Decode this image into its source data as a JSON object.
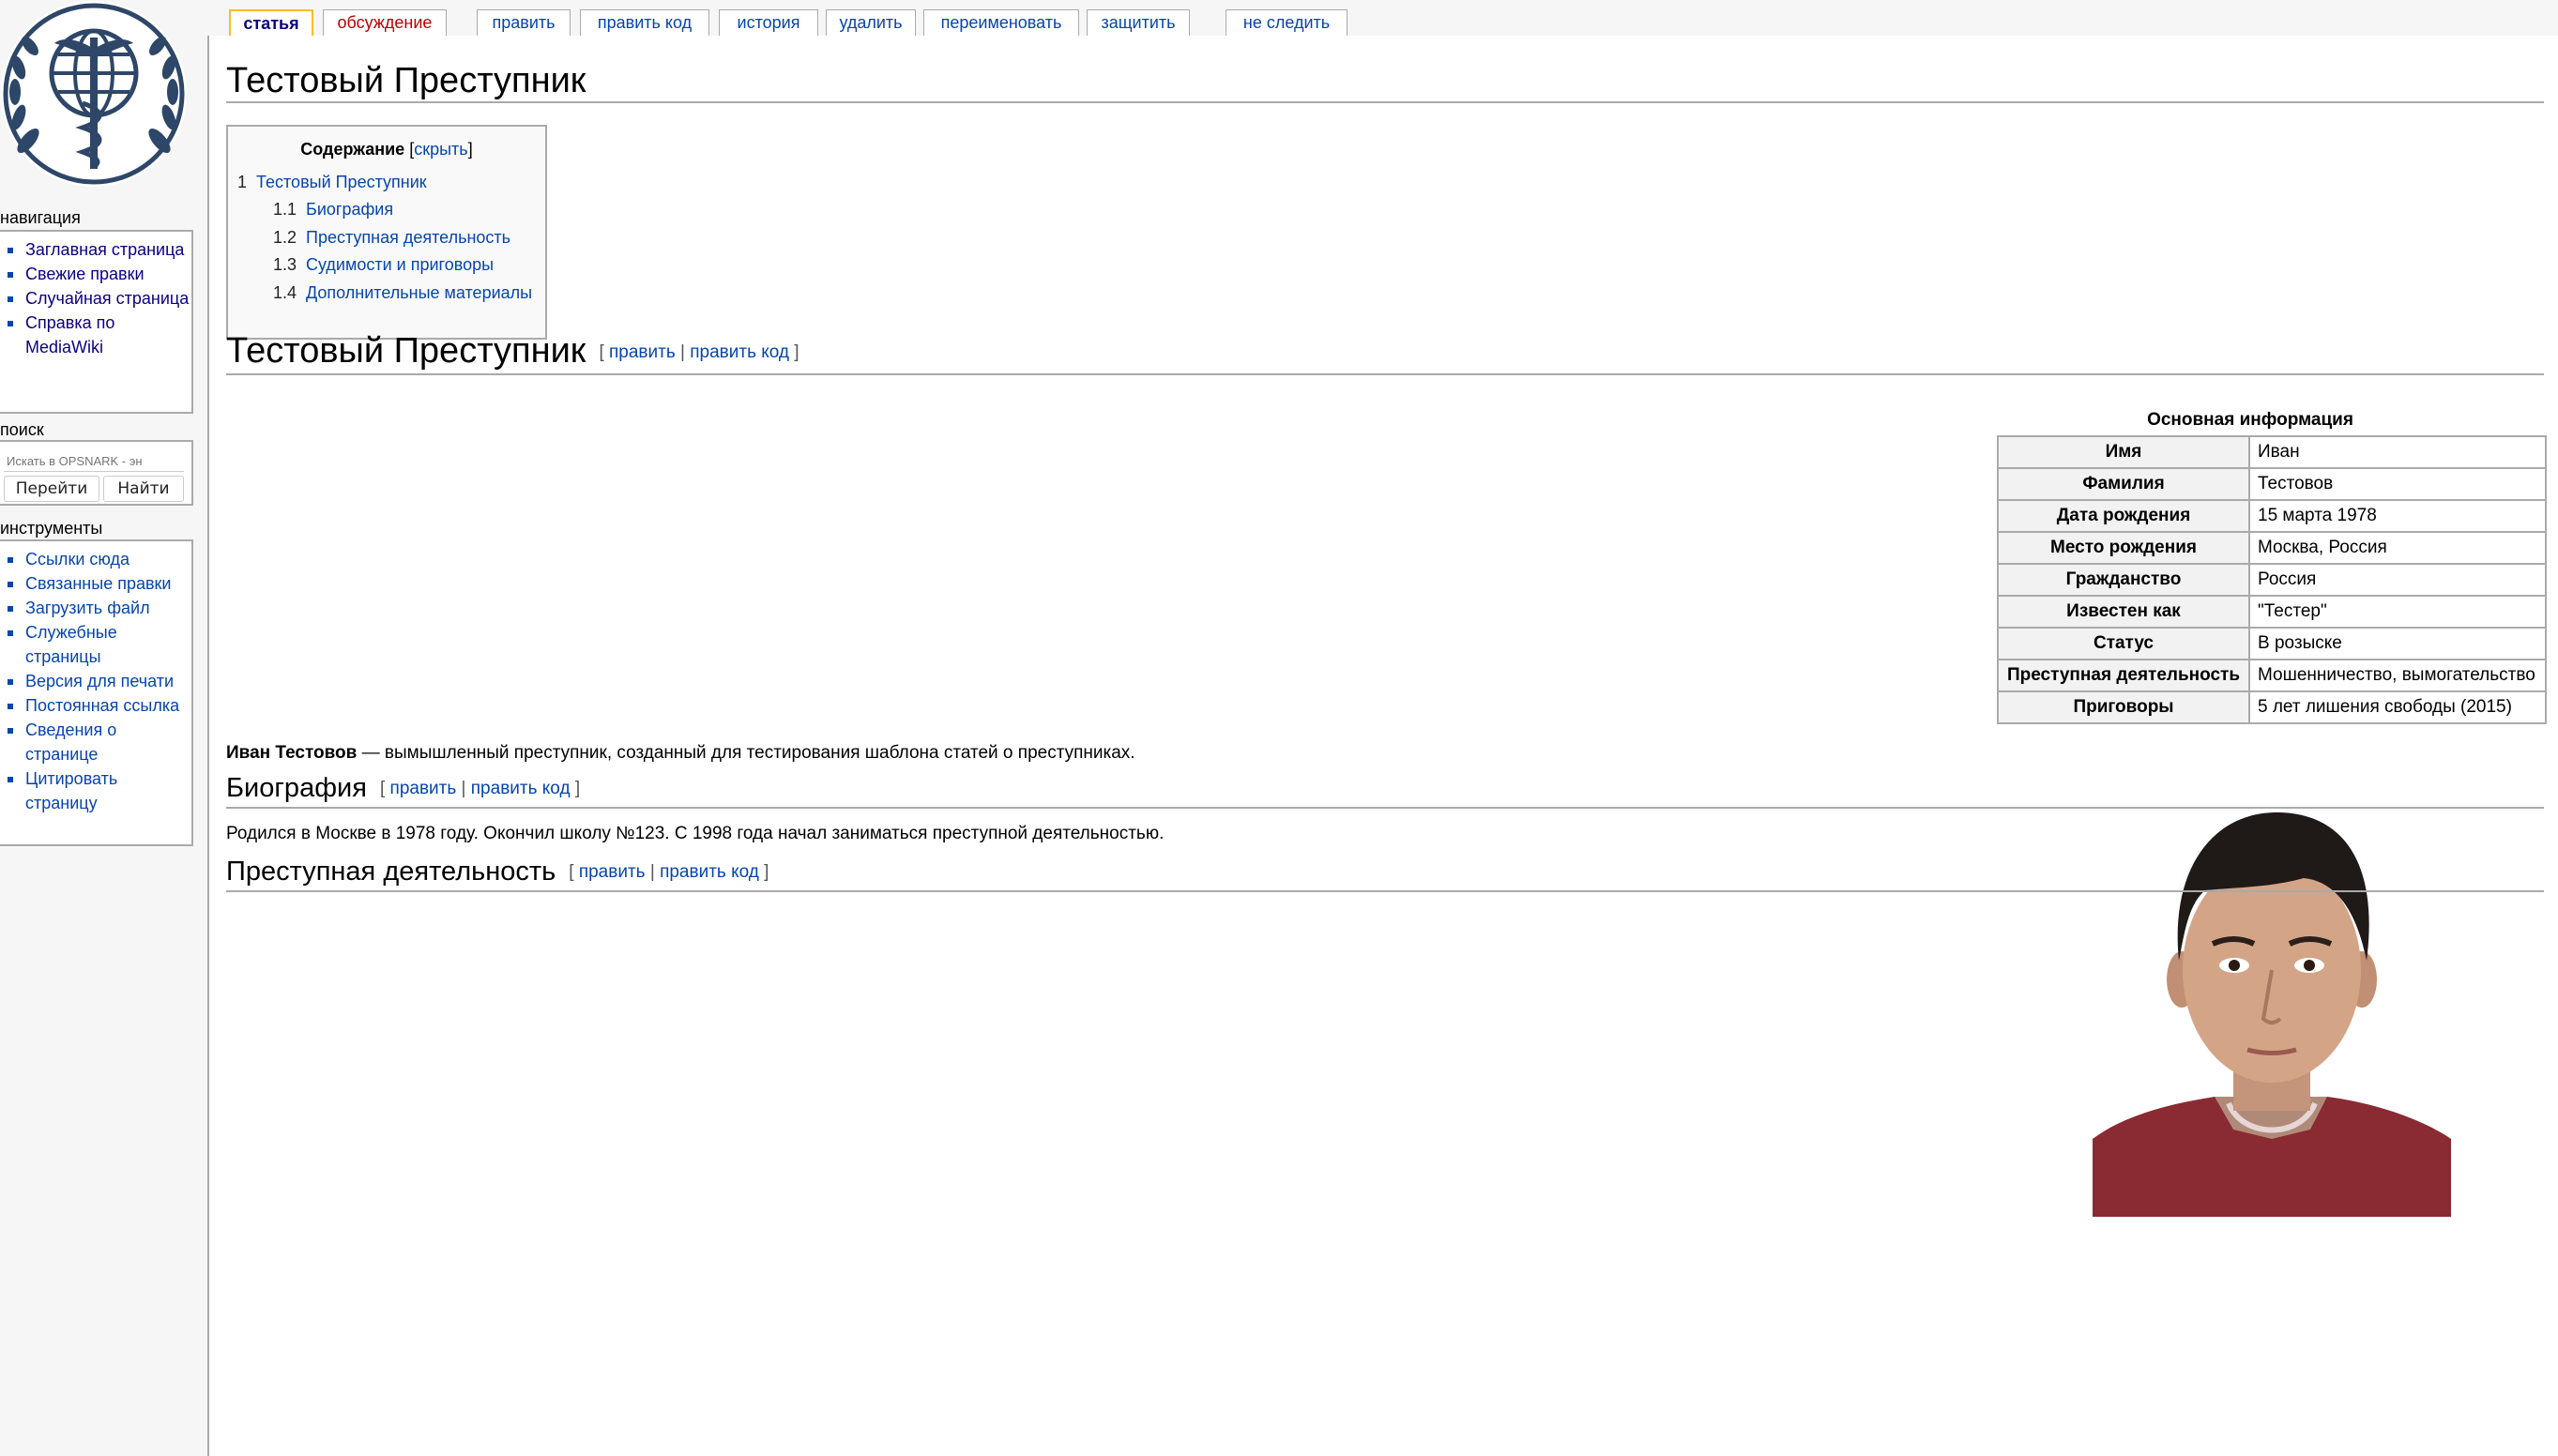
{
  "sidebar": {
    "navigation_title": "навигация",
    "navigation": [
      "Заглавная страница",
      "Свежие правки",
      "Случайная страница",
      "Справка по MediaWiki"
    ],
    "search_title": "поиск",
    "search_placeholder": "Искать в OPSNARK - эн",
    "go_button": "Перейти",
    "find_button": "Найти",
    "tools_title": "инструменты",
    "tools": [
      "Ссылки сюда",
      "Связанные правки",
      "Загрузить файл",
      "Служебные страницы",
      "Версия для печати",
      "Постоянная ссылка",
      "Сведения о странице",
      "Цитировать страницу"
    ]
  },
  "tabs": [
    "статья",
    "обсуждение",
    "править",
    "править код",
    "история",
    "удалить",
    "переименовать",
    "защитить",
    "не следить"
  ],
  "page_title": "Тестовый Преступник",
  "toc": {
    "title": "Содержание",
    "toggle": "скрыть",
    "items": [
      {
        "num": "1",
        "text": "Тестовый Преступник"
      },
      {
        "num": "1.1",
        "text": "Биография"
      },
      {
        "num": "1.2",
        "text": "Преступная деятельность"
      },
      {
        "num": "1.3",
        "text": "Судимости и приговоры"
      },
      {
        "num": "1.4",
        "text": "Дополнительные материалы"
      }
    ]
  },
  "edit_links": {
    "edit": "править",
    "edit_source": "править код"
  },
  "section_main": "Тестовый Преступник",
  "infobox": {
    "caption": "Основная информация",
    "rows": [
      {
        "label": "Имя",
        "value": "Иван"
      },
      {
        "label": "Фамилия",
        "value": "Тестовов"
      },
      {
        "label": "Дата рождения",
        "value": "15 марта 1978"
      },
      {
        "label": "Место рождения",
        "value": "Москва, Россия"
      },
      {
        "label": "Гражданство",
        "value": "Россия"
      },
      {
        "label": "Известен как",
        "value": "\"Тестер\""
      },
      {
        "label": "Статус",
        "value": "В розыске"
      },
      {
        "label": "Преступная деятельность",
        "value": "Мошенничество, вымогательство"
      },
      {
        "label": "Приговоры",
        "value": "5 лет лишения свободы (2015)"
      }
    ]
  },
  "intro": {
    "bold": "Иван Тестовов",
    "rest": " — вымышленный преступник, созданный для тестирования шаблона статей о преступниках."
  },
  "section_bio": "Биография",
  "bio_text": "Родился в Москве в 1978 году. Окончил школу №123. С 1998 года начал заниматься преступной деятельностью.",
  "section_crime": "Преступная деятельность",
  "colors": {
    "link": "#0645ad",
    "visited": "#0b0080",
    "new": "#ba0000",
    "border": "#aaa",
    "tab_selected": "#fabd23"
  }
}
